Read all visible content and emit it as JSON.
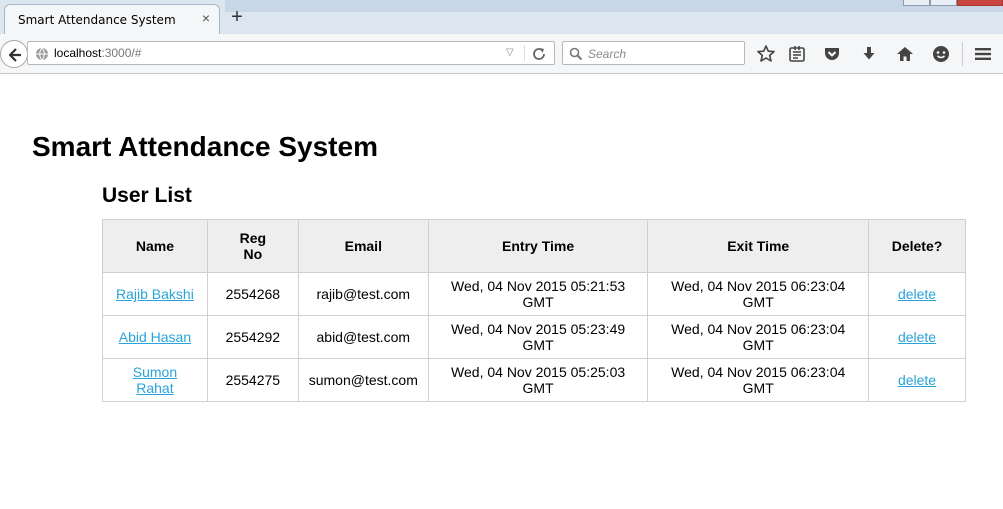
{
  "browser": {
    "tab_title": "Smart Attendance System",
    "tab_close": "×",
    "new_tab": "+",
    "url_host": "localhost",
    "url_path": ":3000/#",
    "search_placeholder": "Search",
    "toolbar_icons": [
      "bookmark-star-icon",
      "reading-list-icon",
      "pocket-icon",
      "download-icon",
      "home-icon",
      "chat-icon",
      "hamburger-menu-icon"
    ]
  },
  "page": {
    "title": "Smart Attendance System",
    "section_title": "User List"
  },
  "table": {
    "headers": {
      "name": "Name",
      "reg_line1": "Reg",
      "reg_line2": "No",
      "email": "Email",
      "entry_time": "Entry Time",
      "exit_time": "Exit Time",
      "delete": "Delete?"
    },
    "rows": [
      {
        "name_line1": "Rajib Bakshi",
        "name_line2": "",
        "reg_no": "2554268",
        "email": "rajib@test.com",
        "entry_line1": "Wed, 04 Nov 2015 05:21:53",
        "entry_line2": "GMT",
        "exit_line1": "Wed, 04 Nov 2015 06:23:04",
        "exit_line2": "GMT",
        "delete": "delete"
      },
      {
        "name_line1": "Abid Hasan",
        "name_line2": "",
        "reg_no": "2554292",
        "email": "abid@test.com",
        "entry_line1": "Wed, 04 Nov 2015 05:23:49",
        "entry_line2": "GMT",
        "exit_line1": "Wed, 04 Nov 2015 06:23:04",
        "exit_line2": "GMT",
        "delete": "delete"
      },
      {
        "name_line1": "Sumon",
        "name_line2": "Rahat",
        "reg_no": "2554275",
        "email": "sumon@test.com",
        "entry_line1": "Wed, 04 Nov 2015 05:25:03",
        "entry_line2": "GMT",
        "exit_line1": "Wed, 04 Nov 2015 06:23:04",
        "exit_line2": "GMT",
        "delete": "delete"
      }
    ]
  },
  "colors": {
    "link": "#29a3d8",
    "header_bg": "#eeeeee",
    "border": "#d0d0d0",
    "chrome_bg": "#f5f6f7"
  }
}
